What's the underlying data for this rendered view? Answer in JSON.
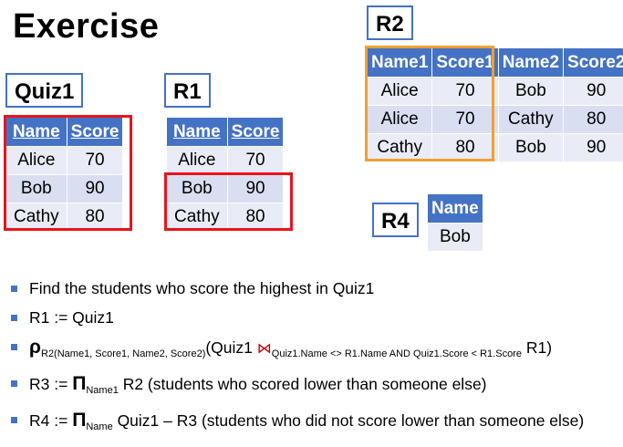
{
  "title": "Exercise",
  "quiz1": {
    "label": "Quiz1",
    "headers": [
      "Name",
      "Score"
    ],
    "rows": [
      [
        "Alice",
        "70"
      ],
      [
        "Bob",
        "90"
      ],
      [
        "Cathy",
        "80"
      ]
    ]
  },
  "r1": {
    "label": "R1",
    "headers": [
      "Name",
      "Score"
    ],
    "rows": [
      [
        "Alice",
        "70"
      ],
      [
        "Bob",
        "90"
      ],
      [
        "Cathy",
        "80"
      ]
    ]
  },
  "r2": {
    "label": "R2",
    "headers": [
      "Name1",
      "Score1",
      "Name2",
      "Score2"
    ],
    "rows": [
      [
        "Alice",
        "70",
        "Bob",
        "90"
      ],
      [
        "Alice",
        "70",
        "Cathy",
        "80"
      ],
      [
        "Cathy",
        "80",
        "Bob",
        "90"
      ]
    ]
  },
  "r4": {
    "label": "R4",
    "headers": [
      "Name"
    ],
    "rows": [
      [
        "Bob"
      ]
    ]
  },
  "bullets": {
    "b1": "Find the students who score the highest in Quiz1",
    "b2": "R1 := Quiz1",
    "b3": {
      "rho": "ρ",
      "rho_sub": "R2(Name1, Score1, Name2, Score2)",
      "open": "(Quiz1 ",
      "join": "⋈",
      "join_sub": "Quiz1.Name <> R1.Name  AND Quiz1.Score < R1.Score",
      "close": " R1)"
    },
    "b4": {
      "lead": "R3 := ",
      "pi": "Π",
      "pi_sub": "Name1",
      "rest": " R2 (students who scored lower than someone else)"
    },
    "b5": {
      "lead": "R4 := ",
      "pi": "Π",
      "pi_sub": "Name",
      "rest": " Quiz1 – R3 (students who did not score lower than someone else)"
    }
  },
  "colors": {
    "header_blue": "#4472c4",
    "cell_light": "#d9def1",
    "highlight_red": "#e8141b",
    "highlight_orange": "#f0a030"
  }
}
